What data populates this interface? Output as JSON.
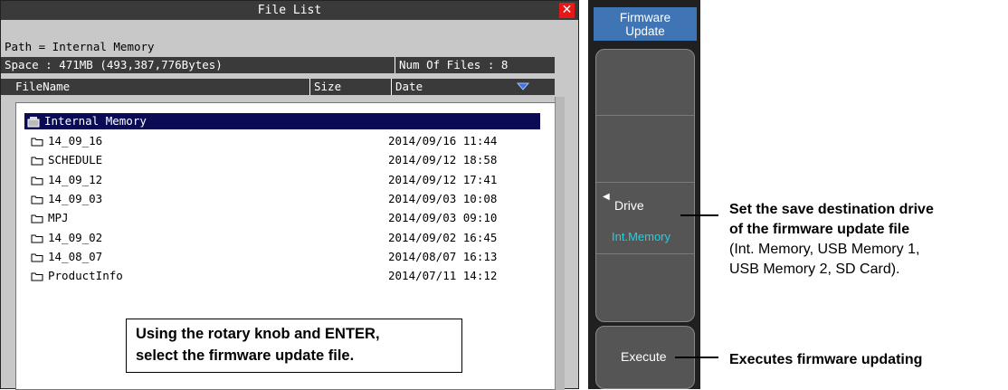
{
  "dialog": {
    "title": "File List",
    "close_icon": "close-icon",
    "path": "Path = Internal Memory",
    "space": "Space : 471MB (493,387,776Bytes)",
    "num_files": "Num Of Files : 8",
    "columns": {
      "name": "FileName",
      "size": "Size",
      "date": "Date"
    },
    "sort_icon": "triangle-down-icon",
    "root": "Internal Memory",
    "rows": [
      {
        "name": "14_09_16",
        "date": "2014/09/16 11:44"
      },
      {
        "name": "SCHEDULE",
        "date": "2014/09/12 18:58"
      },
      {
        "name": "14_09_12",
        "date": "2014/09/12 17:41"
      },
      {
        "name": "14_09_03",
        "date": "2014/09/03 10:08"
      },
      {
        "name": "MPJ",
        "date": "2014/09/03 09:10"
      },
      {
        "name": "14_09_02",
        "date": "2014/09/02 16:45"
      },
      {
        "name": "14_08_07",
        "date": "2014/08/07 16:13"
      },
      {
        "name": "ProductInfo",
        "date": "2014/07/11 14:12"
      }
    ]
  },
  "callout": {
    "line1": "Using the rotary knob and ENTER,",
    "line2": "select the firmware update file."
  },
  "softkeys": {
    "top_line1": "Firmware",
    "top_line2": "Update",
    "drive_label": "Drive",
    "drive_value": "Int.Memory",
    "execute_label": "Execute"
  },
  "annotations": {
    "drive_line1": "Set the save destination drive",
    "drive_line2": "of the firmware update file",
    "drive_line3": "(Int. Memory, USB Memory 1,",
    "drive_line4": "USB Memory 2, SD Card).",
    "execute": "Executes firmware updating"
  },
  "colors": {
    "title_bar": "#3a3a3a",
    "selected_row": "#0b0b55",
    "softkey_top": "#3f75b4",
    "drive_value": "#17d5e8",
    "close_button": "#e61818"
  }
}
